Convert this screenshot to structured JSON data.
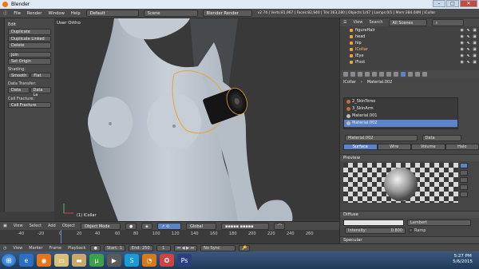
{
  "window": {
    "title": "Blender",
    "controls": [
      "–",
      "□",
      "✕"
    ]
  },
  "info_header": {
    "menus": [
      "File",
      "Render",
      "Window",
      "Help"
    ],
    "layout": "Default",
    "scene": "Scene",
    "engine": "Blender Render",
    "stats": "v2.74 | Verts:81,967 | Faces:82,940 | Tris:163,280 | Objects:1/47 | Lamps:0/1 | Mem:384.04M | lCollar"
  },
  "toolbar": {
    "edit_header": "Edit",
    "duplicate": "Duplicate",
    "duplicate_linked": "Duplicate Linked",
    "delete": "Delete",
    "join": "Join",
    "set_origin": "Set Origin",
    "shading_label": "Shading:",
    "smooth": "Smooth",
    "flat": "Flat",
    "data_transfer_label": "Data Transfer:",
    "data": "Data",
    "data_layers": "Data La",
    "cloth_fracture_label": "Cell Fracture:",
    "cell_fracture": "Cell Fracture"
  },
  "viewport": {
    "view_label": "User Ortho",
    "object_label": "(1) lCollar"
  },
  "viewport_header": {
    "menus": [
      "View",
      "Select",
      "Add",
      "Object"
    ],
    "mode": "Object Mode",
    "pivot": "Global"
  },
  "timeline": {
    "ticks": [
      "-40",
      "-20",
      "0",
      "20",
      "40",
      "60",
      "80",
      "100",
      "120",
      "140",
      "160",
      "180",
      "200",
      "220",
      "240",
      "260"
    ],
    "menus": [
      "View",
      "Marker",
      "Frame",
      "Playback"
    ],
    "start_label": "Start:",
    "start": "1",
    "end_label": "End:",
    "end": "250",
    "current": "1",
    "sync": "No Sync"
  },
  "outliner": {
    "menus": [
      "View",
      "Search"
    ],
    "filter": "All Scenes",
    "items": [
      "figureHair",
      "head",
      "hip",
      "lCollar",
      "lEye",
      "lFoot"
    ]
  },
  "properties": {
    "breadcrumb_object": "lCollar",
    "breadcrumb_material": "Material.002",
    "materials": [
      "2_SkinTorso",
      "3_SkinArm",
      "Material.001",
      "Material.002"
    ],
    "active_material": "Material.002",
    "material_field": "Material.002",
    "data_field": "Data",
    "type_tabs": [
      "Surface",
      "Wire",
      "Volume",
      "Halo"
    ],
    "preview_header": "Preview",
    "diffuse_header": "Diffuse",
    "shader": "Lambert",
    "intensity_label": "Intensity:",
    "intensity_value": "0.800",
    "ramp": "Ramp",
    "specular_header": "Specular"
  },
  "taskbar": {
    "time": "5:27 PM",
    "date": "5/6/2015"
  },
  "colors": {
    "accent": "#5b83c9",
    "selection_orange": "#e9a33b"
  }
}
